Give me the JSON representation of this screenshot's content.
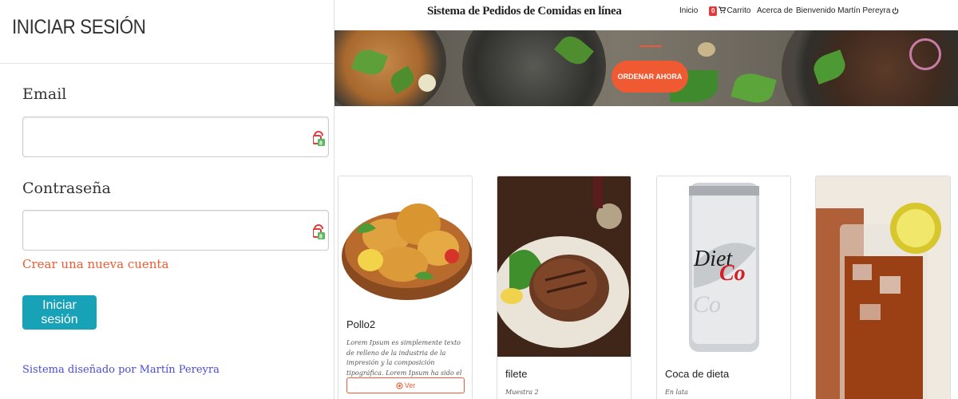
{
  "navbar": {
    "brand": "Sistema de Pedidos de Comidas en línea",
    "home": "Inicio",
    "cart_count": "0",
    "cart": "Carrito",
    "about": "Acerca de",
    "welcome": "Bienvenido Martín Pereyra",
    "icons": {
      "cart": "shopping-cart-icon",
      "logout": "power-icon"
    }
  },
  "hero": {
    "order_button": "ORDENAR AHORA"
  },
  "login": {
    "title": "INICIAR SESIÓN",
    "email_label": "Email",
    "email_value": "",
    "password_label": "Contraseña",
    "password_value": "",
    "create_account": "Crear una nueva cuenta",
    "submit": "Iniciar sesión",
    "designed_by": "Sistema diseñado por Martín Pereyra"
  },
  "products": [
    {
      "name": "Pollo2",
      "description": "Lorem Ipsum es simplemente texto de relleno de la industria de la impresión y la composición tipográfica. Lorem Ipsum ha sido el texto de...",
      "button": "Ver"
    },
    {
      "name": "filete",
      "description": "Muestra 2"
    },
    {
      "name": "Coca de dieta",
      "description": "En lata"
    },
    {
      "name": ""
    }
  ],
  "colors": {
    "accent": "#ef5a32",
    "primary": "#17a2b8",
    "link": "#4a4ad8",
    "badge": "#e23b3b"
  }
}
